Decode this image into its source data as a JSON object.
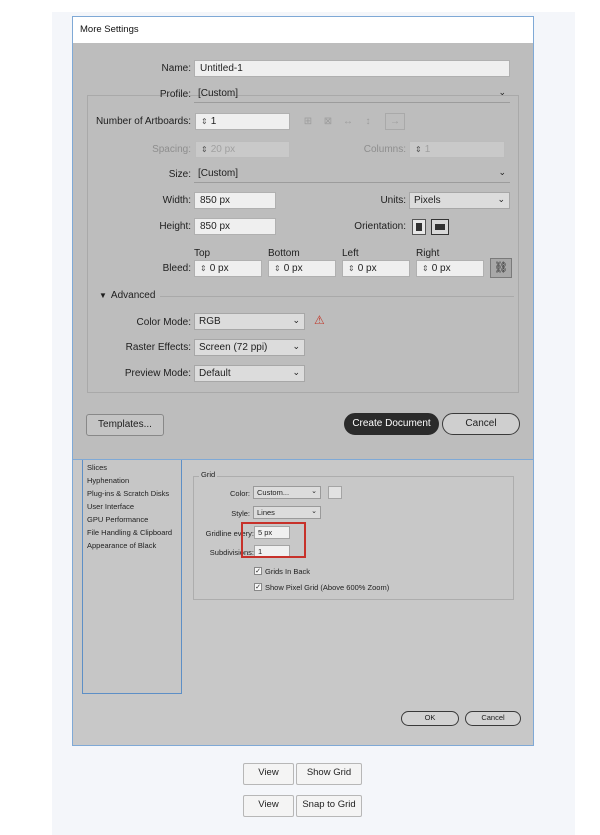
{
  "more_settings": {
    "title": "More Settings",
    "name_label": "Name:",
    "name_value": "Untitled-1",
    "profile_label": "Profile:",
    "profile_value": "[Custom]",
    "artboards_label": "Number of Artboards:",
    "artboards_value": "1",
    "spacing_label": "Spacing:",
    "spacing_value": "20 px",
    "columns_label": "Columns:",
    "columns_value": "1",
    "size_label": "Size:",
    "size_value": "[Custom]",
    "width_label": "Width:",
    "width_value": "850 px",
    "units_label": "Units:",
    "units_value": "Pixels",
    "height_label": "Height:",
    "height_value": "850 px",
    "orientation_label": "Orientation:",
    "bleed_label": "Bleed:",
    "bleed_top_label": "Top",
    "bleed_top_value": "0 px",
    "bleed_bottom_label": "Bottom",
    "bleed_bottom_value": "0 px",
    "bleed_left_label": "Left",
    "bleed_left_value": "0 px",
    "bleed_right_label": "Right",
    "bleed_right_value": "0 px",
    "advanced_label": "Advanced",
    "color_mode_label": "Color Mode:",
    "color_mode_value": "RGB",
    "raster_label": "Raster Effects:",
    "raster_value": "Screen (72 ppi)",
    "preview_label": "Preview Mode:",
    "preview_value": "Default",
    "templates_button": "Templates...",
    "create_button": "Create Document",
    "cancel_button": "Cancel"
  },
  "preferences": {
    "list_items": [
      "Slices",
      "Hyphenation",
      "Plug-ins & Scratch Disks",
      "User Interface",
      "GPU Performance",
      "File Handling & Clipboard",
      "Appearance of Black"
    ],
    "grid_title": "Grid",
    "color_label": "Color:",
    "color_value": "Custom...",
    "style_label": "Style:",
    "style_value": "Lines",
    "gridline_label": "Gridline every:",
    "gridline_value": "5 px",
    "subdivisions_label": "Subdivisions:",
    "subdivisions_value": "1",
    "grids_in_back_label": "Grids In Back",
    "grids_in_back_checked": true,
    "pixel_grid_label": "Show Pixel Grid (Above 600% Zoom)",
    "pixel_grid_checked": true,
    "ok_button": "OK",
    "cancel_button": "Cancel"
  },
  "toolbar_rows": [
    {
      "menu": "View",
      "command": "Show Grid"
    },
    {
      "menu": "View",
      "command": "Snap to Grid"
    }
  ],
  "colors": {
    "highlight": "#c7312a",
    "warning": "#c0392b",
    "primary_button": "#2b2b2b",
    "dialog_border": "#7fa9d6"
  }
}
